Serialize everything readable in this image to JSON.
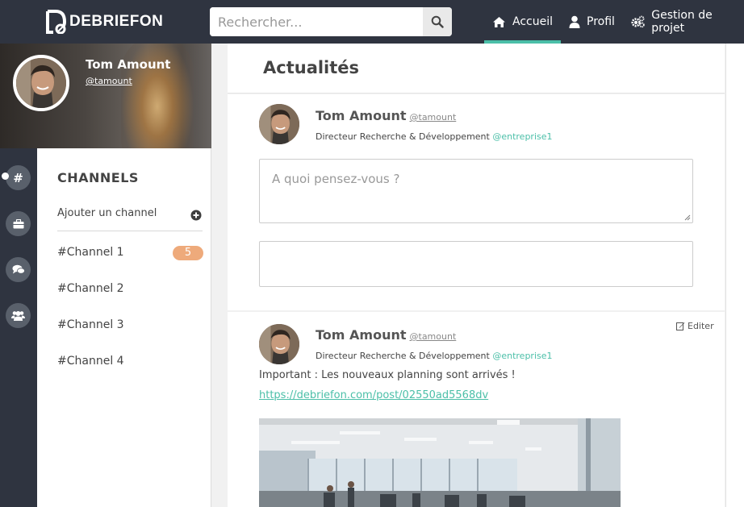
{
  "app": {
    "logo_text": "DEBRIEFON"
  },
  "search": {
    "placeholder": "Rechercher..."
  },
  "nav": {
    "items": [
      {
        "label": "Accueil",
        "icon": "home-icon",
        "active": true
      },
      {
        "label": "Profil",
        "icon": "user-icon",
        "active": false
      },
      {
        "label": "Gestion de projet",
        "icon": "gears-icon",
        "active": false
      }
    ]
  },
  "profile": {
    "name": "Tom Amount",
    "handle": "@tamount"
  },
  "rail": {
    "items": [
      "hashtag-icon",
      "briefcase-icon",
      "comments-icon",
      "users-icon"
    ]
  },
  "channels": {
    "title": "CHANNELS",
    "add_label": "Ajouter un channel",
    "items": [
      {
        "label": "#Channel 1",
        "badge": "5"
      },
      {
        "label": "#Channel 2"
      },
      {
        "label": "#Channel 3"
      },
      {
        "label": "#Channel 4"
      }
    ]
  },
  "feed": {
    "title": "Actualités",
    "composer": {
      "name": "Tom Amount",
      "handle": "@tamount",
      "role": "Directeur Recherche & Développement",
      "org": "@entreprise1",
      "placeholder": "A quoi pensez-vous ?"
    },
    "post": {
      "name": "Tom Amount",
      "handle": "@tamount",
      "role": "Directeur Recherche & Développement",
      "org": "@entreprise1",
      "edit_label": "Editer",
      "text": "Important : Les nouveaux planning sont arrivés !",
      "link": "https://debriefon.com/post/02550ad5568dv"
    }
  },
  "colors": {
    "topbar": "#2f3440",
    "accent": "#4bbfa8",
    "badge": "#eeaa7b"
  }
}
